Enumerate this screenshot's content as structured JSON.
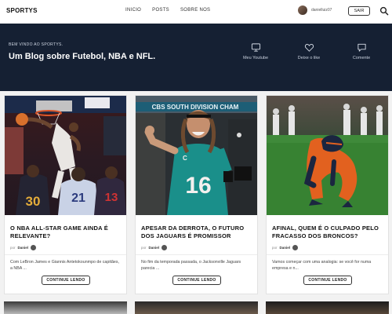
{
  "header": {
    "logo": "SPORTYS",
    "nav": [
      "INICIO",
      "POSTS",
      "SOBRE NOS"
    ],
    "username": "danielluiz07",
    "logout_label": "SAIR"
  },
  "hero": {
    "welcome": "BEM VINDO AO SPORTYS.",
    "title": "Um Blog sobre Futebol, NBA e NFL.",
    "actions": [
      {
        "label": "Meu Youtube",
        "icon": "monitor-icon"
      },
      {
        "label": "Deixe o like",
        "icon": "heart-icon"
      },
      {
        "label": "Comente",
        "icon": "comment-icon"
      }
    ]
  },
  "posts": [
    {
      "title": "O NBA ALL-STAR GAME AINDA É RELEVANTE?",
      "by": "por",
      "author": "Daniel",
      "excerpt": "Com LeBron James e Giannis Antetokounmpo de capitães, a NBA ...",
      "button": "CONTINUE LENDO",
      "image_text": [
        "30",
        "21",
        "13"
      ]
    },
    {
      "title": "APESAR DA DERROTA, O FUTURO DOS JAGUARS É PROMISSOR",
      "by": "por",
      "author": "Daniel",
      "excerpt": "No fim da temporada passada, o Jacksonville Jaguars parecia ...",
      "button": "CONTINUE LENDO",
      "image_text": [
        "16",
        "C",
        "CBS SOUTH DIVISION CHAM"
      ]
    },
    {
      "title": "AFINAL, QUEM É O CULPADO PELO FRACASSO DOS BRONCOS?",
      "by": "por",
      "author": "Daniel",
      "excerpt": "Vamos começar com uma analogia: se você for numa empresa e n...",
      "button": "CONTINUE LENDO",
      "image_text": []
    }
  ],
  "colors": {
    "hero_bg": "#152033",
    "page_bg": "#f2f2f2",
    "jaguars_teal": "#1a8f8a",
    "broncos_orange": "#e2611f"
  }
}
